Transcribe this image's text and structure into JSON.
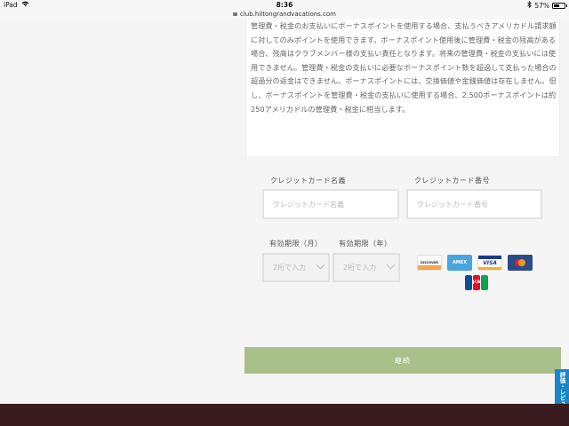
{
  "status_bar": {
    "device": "iPad",
    "time": "8:36",
    "battery": "57%",
    "battery_level": 0.57
  },
  "address_bar": {
    "url": "club.hiltongrandvacations.com"
  },
  "notice": {
    "text": "管理費・税金のお支払いにボーナスポイントを使用する場合、支払うべきアメリカドル請求額に対してのみポイントを使用できます。ボーナスポイント使用後に管理費・税金の残高がある場合、残高はクラブメンバー様の支払い責任となります。将来の管理費・税金の支払いには使用できません。管理費・税金の支払いに必要なボーナスポイント数を超過して支払った場合の超過分の返金はできません。ボーナスポイントには、交換価値や金銭価値は存在しません。但し、ボーナスポイントを管理費・税金の支払いに使用する場合、2,500ボーナスポイントは約250アメリカドルの管理費・税金に相当します。"
  },
  "form": {
    "card_name_label": "クレジットカード名義",
    "card_name_placeholder": "クレジットカード名義",
    "card_number_label": "クレジットカード番号",
    "card_number_placeholder": "クレジットカード番号",
    "exp_month_label": "有効期限（月）",
    "exp_month_placeholder": "2桁で入力",
    "exp_year_label": "有効期限（年）",
    "exp_year_placeholder": "2桁で入力"
  },
  "card_brands": {
    "discover": "DISCOVER",
    "amex": "AMEX",
    "visa": "VISA",
    "jcb": "JCB"
  },
  "continue_button": {
    "label": "継続"
  },
  "review_tab": {
    "label": "評価・レビュー"
  },
  "colors": {
    "continue_button": "#a9c08a",
    "footer": "#3a1c20",
    "review_tab": "#1a86c8"
  }
}
